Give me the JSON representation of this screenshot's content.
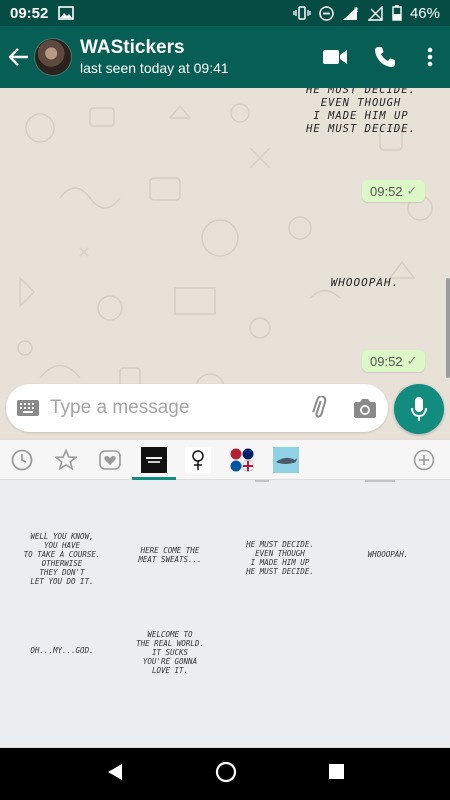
{
  "status_bar": {
    "time": "09:52",
    "battery": "46%"
  },
  "header": {
    "title": "WAStickers",
    "subtitle": "last seen today at 09:41"
  },
  "chat": {
    "messages": [
      {
        "sticker_text": "HE MUST DECIDE.\nEVEN THOUGH\nI MADE HIM UP\nHE MUST DECIDE.",
        "time": "09:52"
      },
      {
        "sticker_text": "WHOOOPAH.",
        "time": "09:52"
      }
    ]
  },
  "composer": {
    "placeholder": "Type a message"
  },
  "sticker_tabs": [
    {
      "name": "recent-tab"
    },
    {
      "name": "favorites-tab"
    },
    {
      "name": "loved-tab"
    },
    {
      "name": "pack-1",
      "active": true
    },
    {
      "name": "pack-2"
    },
    {
      "name": "pack-3"
    },
    {
      "name": "pack-4"
    }
  ],
  "stickers": [
    "WELL YOU KNOW,\nYOU HAVE\nTO TAKE A COURSE.\nOTHERWISE\nTHEY DON'T\nLET YOU DO IT.",
    "HERE COME THE\nMEAT SWEATS...",
    "HE MUST DECIDE.\nEVEN THOUGH\nI MADE HIM UP\nHE MUST DECIDE.",
    "WHOOOPAH.",
    "OH...MY...GOD.",
    "WELCOME TO\nTHE REAL WORLD.\nIT SUCKS\nYOU'RE GONNA\nLOVE IT."
  ],
  "colors": {
    "header": "#075e54",
    "accent": "#128c7e",
    "bubble": "#dcf8c6"
  }
}
